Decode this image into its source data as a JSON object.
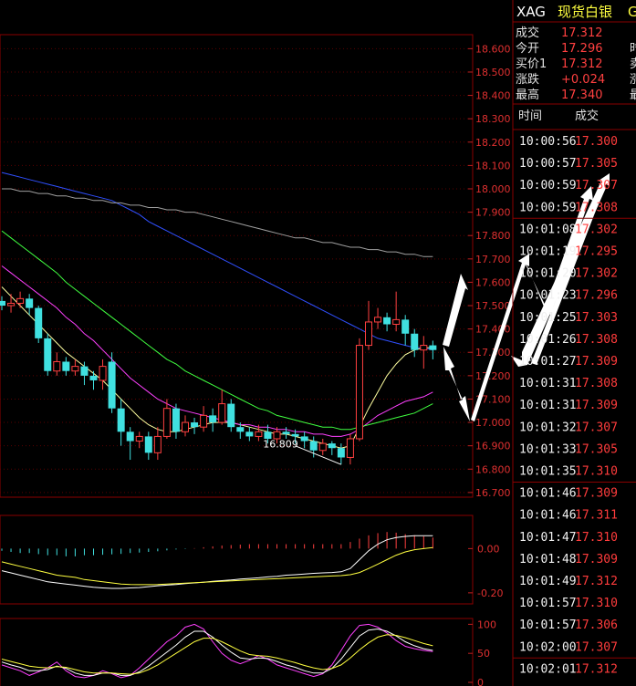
{
  "header": {
    "symbol": "XAG",
    "name": "现货白银",
    "name_suffix": "G"
  },
  "quote": [
    {
      "label": "成交",
      "value": "17.312"
    },
    {
      "label": "今开",
      "value": "17.296"
    },
    {
      "label": "买价1",
      "value": "17.312"
    },
    {
      "label": "涨跌",
      "value": "+0.024"
    },
    {
      "label": "最高",
      "value": "17.340"
    }
  ],
  "quote_cut": [
    "时",
    "卖",
    "涨",
    "最"
  ],
  "tick_table": {
    "columns": [
      "时间",
      "成交"
    ],
    "rows": [
      [
        "10:00:56",
        "17.300"
      ],
      [
        "10:00:57",
        "17.305"
      ],
      [
        "10:00:59",
        "17.307"
      ],
      [
        "10:00:59",
        "17.308"
      ],
      [
        "10:01:08",
        "17.302"
      ],
      [
        "10:01:19",
        "17.295"
      ],
      [
        "10:01:20",
        "17.302"
      ],
      [
        "10:01:23",
        "17.296"
      ],
      [
        "10:01:25",
        "17.303"
      ],
      [
        "10:01:26",
        "17.308"
      ],
      [
        "10:01:27",
        "17.309"
      ],
      [
        "10:01:31",
        "17.308"
      ],
      [
        "10:01:31",
        "17.309"
      ],
      [
        "10:01:32",
        "17.307"
      ],
      [
        "10:01:33",
        "17.305"
      ],
      [
        "10:01:35",
        "17.310"
      ],
      [
        "10:01:46",
        "17.309"
      ],
      [
        "10:01:46",
        "17.311"
      ],
      [
        "10:01:47",
        "17.310"
      ],
      [
        "10:01:48",
        "17.309"
      ],
      [
        "10:01:49",
        "17.312"
      ],
      [
        "10:01:57",
        "17.310"
      ],
      [
        "10:01:57",
        "17.306"
      ],
      [
        "10:02:00",
        "17.307"
      ],
      [
        "10:02:01",
        "17.312"
      ]
    ]
  },
  "colors": {
    "up": "#ff4040",
    "down": "#40e0e0",
    "grid": "#8a0000",
    "axis": "#e03030"
  },
  "chart_data": [
    {
      "type": "candlestick",
      "panel": "price",
      "ylim": [
        16.68,
        18.66
      ],
      "y_ticks": [
        "18.600",
        "18.500",
        "18.400",
        "18.300",
        "18.200",
        "18.100",
        "18.000",
        "17.900",
        "17.800",
        "17.700",
        "17.600",
        "17.500",
        "17.400",
        "17.300",
        "17.200",
        "17.100",
        "17.000",
        "16.900",
        "16.800",
        "16.700"
      ],
      "annotation": {
        "text": "16.809",
        "value": 16.809,
        "index": 30
      },
      "candles": [
        [
          17.52,
          17.5,
          17.54,
          17.48
        ],
        [
          17.5,
          17.51,
          17.55,
          17.47
        ],
        [
          17.51,
          17.53,
          17.56,
          17.49
        ],
        [
          17.53,
          17.49,
          17.55,
          17.46
        ],
        [
          17.49,
          17.36,
          17.5,
          17.34
        ],
        [
          17.36,
          17.22,
          17.38,
          17.2
        ],
        [
          17.22,
          17.26,
          17.3,
          17.2
        ],
        [
          17.26,
          17.22,
          17.28,
          17.2
        ],
        [
          17.22,
          17.24,
          17.27,
          17.2
        ],
        [
          17.24,
          17.2,
          17.26,
          17.16
        ],
        [
          17.2,
          17.18,
          17.22,
          17.14
        ],
        [
          17.18,
          17.24,
          17.27,
          17.14
        ],
        [
          17.26,
          17.06,
          17.3,
          17.04
        ],
        [
          17.06,
          16.96,
          17.1,
          16.9
        ],
        [
          16.96,
          16.92,
          16.98,
          16.84
        ],
        [
          16.92,
          16.94,
          16.96,
          16.89
        ],
        [
          16.94,
          16.87,
          16.96,
          16.84
        ],
        [
          16.87,
          16.94,
          16.98,
          16.84
        ],
        [
          16.94,
          17.06,
          17.1,
          16.93
        ],
        [
          17.06,
          16.96,
          17.08,
          16.93
        ],
        [
          16.96,
          17.0,
          17.03,
          16.94
        ],
        [
          17.0,
          16.98,
          17.02,
          16.95
        ],
        [
          16.98,
          17.03,
          17.07,
          16.96
        ],
        [
          17.03,
          17.0,
          17.06,
          16.96
        ],
        [
          17.0,
          17.08,
          17.14,
          16.99
        ],
        [
          17.08,
          16.98,
          17.1,
          16.96
        ],
        [
          16.98,
          16.96,
          17.0,
          16.93
        ],
        [
          16.96,
          16.94,
          16.98,
          16.92
        ],
        [
          16.94,
          16.96,
          16.99,
          16.92
        ],
        [
          16.96,
          16.93,
          16.99,
          16.91
        ],
        [
          16.93,
          16.96,
          16.98,
          16.91
        ],
        [
          16.96,
          16.95,
          16.98,
          16.93
        ],
        [
          16.95,
          16.94,
          16.97,
          16.91
        ],
        [
          16.94,
          16.92,
          16.96,
          16.89
        ],
        [
          16.92,
          16.88,
          16.94,
          16.85
        ],
        [
          16.88,
          16.91,
          16.93,
          16.86
        ],
        [
          16.91,
          16.89,
          16.92,
          16.86
        ],
        [
          16.89,
          16.85,
          16.91,
          16.82
        ],
        [
          16.85,
          16.93,
          16.95,
          16.82
        ],
        [
          16.93,
          17.33,
          17.36,
          16.92
        ],
        [
          17.33,
          17.43,
          17.52,
          17.31
        ],
        [
          17.43,
          17.45,
          17.49,
          17.4
        ],
        [
          17.45,
          17.42,
          17.47,
          17.39
        ],
        [
          17.42,
          17.44,
          17.56,
          17.39
        ],
        [
          17.44,
          17.38,
          17.46,
          17.33
        ],
        [
          17.38,
          17.31,
          17.4,
          17.28
        ],
        [
          17.31,
          17.33,
          17.37,
          17.23
        ],
        [
          17.33,
          17.31,
          17.35,
          17.27
        ]
      ],
      "series": [
        {
          "name": "",
          "color": "#ffffa0",
          "values": [
            17.58,
            17.54,
            17.5,
            17.46,
            17.42,
            17.38,
            17.34,
            17.3,
            17.27,
            17.24,
            17.21,
            17.18,
            17.14,
            17.1,
            17.06,
            17.02,
            16.99,
            16.97,
            16.96,
            16.96,
            16.97,
            16.98,
            16.99,
            17.0,
            17.0,
            17.0,
            16.99,
            16.98,
            16.97,
            16.96,
            16.95,
            16.95,
            16.94,
            16.93,
            16.92,
            16.91,
            16.9,
            16.89,
            16.9,
            16.98,
            17.06,
            17.13,
            17.2,
            17.25,
            17.29,
            17.31,
            17.32,
            17.32
          ]
        },
        {
          "name": "",
          "color": "#ff40ff",
          "values": [
            17.67,
            17.64,
            17.61,
            17.58,
            17.55,
            17.52,
            17.49,
            17.45,
            17.42,
            17.38,
            17.35,
            17.31,
            17.27,
            17.23,
            17.19,
            17.16,
            17.13,
            17.1,
            17.08,
            17.06,
            17.05,
            17.04,
            17.03,
            17.02,
            17.01,
            17.0,
            16.99,
            16.99,
            16.98,
            16.98,
            16.97,
            16.97,
            16.96,
            16.96,
            16.95,
            16.95,
            16.94,
            16.94,
            16.95,
            16.97,
            17.0,
            17.03,
            17.05,
            17.07,
            17.09,
            17.1,
            17.11,
            17.13
          ]
        },
        {
          "name": "",
          "color": "#40ff40",
          "values": [
            17.82,
            17.79,
            17.76,
            17.73,
            17.7,
            17.67,
            17.64,
            17.6,
            17.57,
            17.54,
            17.51,
            17.48,
            17.45,
            17.42,
            17.39,
            17.36,
            17.33,
            17.3,
            17.27,
            17.25,
            17.22,
            17.2,
            17.18,
            17.16,
            17.14,
            17.12,
            17.1,
            17.08,
            17.06,
            17.05,
            17.03,
            17.02,
            17.01,
            17.0,
            16.99,
            16.98,
            16.98,
            16.97,
            16.97,
            16.98,
            16.99,
            17.0,
            17.01,
            17.02,
            17.03,
            17.04,
            17.06,
            17.08
          ]
        },
        {
          "name": "",
          "color": "#3050ff",
          "values": [
            18.07,
            18.06,
            18.05,
            18.04,
            18.03,
            18.02,
            18.01,
            18.0,
            17.99,
            17.98,
            17.97,
            17.96,
            17.95,
            17.93,
            17.91,
            17.89,
            17.86,
            17.84,
            17.82,
            17.8,
            17.78,
            17.76,
            17.74,
            17.72,
            17.7,
            17.68,
            17.66,
            17.64,
            17.62,
            17.6,
            17.58,
            17.56,
            17.54,
            17.52,
            17.5,
            17.48,
            17.46,
            17.44,
            17.42,
            17.4,
            17.38,
            17.36,
            17.35,
            17.34,
            17.33,
            17.32,
            17.32,
            17.31
          ]
        },
        {
          "name": "",
          "color": "#a0a0a0",
          "values": [
            18.0,
            18.0,
            17.99,
            17.99,
            17.98,
            17.98,
            17.97,
            17.97,
            17.96,
            17.96,
            17.95,
            17.95,
            17.94,
            17.94,
            17.93,
            17.93,
            17.92,
            17.92,
            17.91,
            17.91,
            17.9,
            17.9,
            17.89,
            17.88,
            17.87,
            17.86,
            17.85,
            17.84,
            17.83,
            17.82,
            17.81,
            17.8,
            17.79,
            17.79,
            17.78,
            17.77,
            17.77,
            17.76,
            17.75,
            17.75,
            17.74,
            17.74,
            17.73,
            17.73,
            17.72,
            17.72,
            17.71,
            17.71
          ]
        }
      ]
    },
    {
      "type": "macd",
      "panel": "macd",
      "ylim": [
        -0.25,
        0.15
      ],
      "y_ticks": [
        "0.00",
        "-0.20"
      ],
      "histogram": [
        -0.01,
        -0.015,
        -0.02,
        -0.02,
        -0.025,
        -0.03,
        -0.03,
        -0.035,
        -0.035,
        -0.03,
        -0.03,
        -0.028,
        -0.026,
        -0.024,
        -0.02,
        -0.018,
        -0.015,
        -0.012,
        -0.008,
        -0.004,
        -0.002,
        0.002,
        0.006,
        0.01,
        0.014,
        0.016,
        0.018,
        0.02,
        0.02,
        0.02,
        0.02,
        0.02,
        0.02,
        0.02,
        0.02,
        0.02,
        0.02,
        0.02,
        0.03,
        0.045,
        0.06,
        0.07,
        0.075,
        0.072,
        0.065,
        0.06,
        0.055,
        0.05
      ],
      "series": [
        {
          "name": "",
          "color": "#ffffff",
          "values": [
            -0.1,
            -0.11,
            -0.12,
            -0.13,
            -0.14,
            -0.15,
            -0.155,
            -0.16,
            -0.165,
            -0.17,
            -0.175,
            -0.178,
            -0.18,
            -0.18,
            -0.178,
            -0.176,
            -0.172,
            -0.168,
            -0.165,
            -0.162,
            -0.158,
            -0.155,
            -0.152,
            -0.148,
            -0.145,
            -0.142,
            -0.138,
            -0.135,
            -0.132,
            -0.128,
            -0.125,
            -0.12,
            -0.118,
            -0.115,
            -0.112,
            -0.11,
            -0.108,
            -0.105,
            -0.09,
            -0.05,
            -0.01,
            0.02,
            0.04,
            0.05,
            0.055,
            0.058,
            0.058,
            0.058
          ]
        },
        {
          "name": "",
          "color": "#ffff40",
          "values": [
            -0.06,
            -0.07,
            -0.08,
            -0.09,
            -0.1,
            -0.11,
            -0.12,
            -0.125,
            -0.13,
            -0.14,
            -0.145,
            -0.15,
            -0.155,
            -0.16,
            -0.162,
            -0.163,
            -0.163,
            -0.162,
            -0.16,
            -0.158,
            -0.156,
            -0.154,
            -0.152,
            -0.15,
            -0.148,
            -0.146,
            -0.144,
            -0.142,
            -0.14,
            -0.138,
            -0.136,
            -0.134,
            -0.132,
            -0.13,
            -0.128,
            -0.126,
            -0.124,
            -0.122,
            -0.118,
            -0.108,
            -0.09,
            -0.07,
            -0.05,
            -0.03,
            -0.015,
            -0.005,
            0.0,
            0.005
          ]
        }
      ]
    },
    {
      "type": "line",
      "panel": "kdj",
      "ylim": [
        0,
        110
      ],
      "y_ticks": [
        "100",
        "50",
        "0"
      ],
      "series": [
        {
          "name": "",
          "color": "#ff40ff",
          "values": [
            30,
            25,
            20,
            12,
            18,
            25,
            35,
            20,
            10,
            8,
            12,
            20,
            15,
            8,
            12,
            25,
            40,
            55,
            70,
            80,
            95,
            100,
            92,
            70,
            50,
            38,
            32,
            38,
            46,
            40,
            30,
            25,
            20,
            15,
            10,
            15,
            30,
            55,
            80,
            98,
            100,
            95,
            85,
            72,
            62,
            58,
            55,
            53
          ]
        },
        {
          "name": "",
          "color": "#ffffff",
          "values": [
            35,
            30,
            26,
            20,
            20,
            22,
            28,
            24,
            16,
            12,
            12,
            16,
            16,
            12,
            12,
            18,
            28,
            40,
            52,
            64,
            78,
            88,
            88,
            78,
            64,
            52,
            42,
            40,
            42,
            41,
            36,
            30,
            26,
            20,
            16,
            16,
            24,
            40,
            60,
            80,
            90,
            92,
            88,
            80,
            70,
            63,
            58,
            55
          ]
        },
        {
          "name": "",
          "color": "#ffff40",
          "values": [
            40,
            36,
            32,
            28,
            26,
            25,
            27,
            26,
            22,
            18,
            16,
            16,
            16,
            15,
            14,
            16,
            22,
            30,
            40,
            50,
            60,
            70,
            76,
            76,
            70,
            62,
            54,
            48,
            46,
            45,
            42,
            38,
            34,
            29,
            25,
            22,
            24,
            30,
            42,
            56,
            68,
            78,
            82,
            81,
            77,
            72,
            67,
            63
          ]
        }
      ]
    }
  ]
}
